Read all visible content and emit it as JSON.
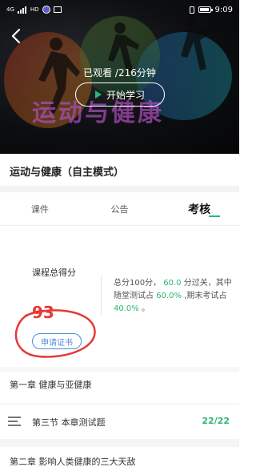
{
  "status_bar": {
    "time": "9:09",
    "network_tag_1": "4G",
    "network_tag_2": "HD"
  },
  "hero": {
    "watched_text": "已观看    /216分钟",
    "start_button": "开始学习",
    "banner_text": "运动与健康"
  },
  "course": {
    "title": "运动与健康（自主模式）"
  },
  "tabs": [
    {
      "label": "课件",
      "active": false
    },
    {
      "label": "公告",
      "active": false
    },
    {
      "label": "考核",
      "active": true
    }
  ],
  "score": {
    "label": "课程总得分",
    "value": "93",
    "apply_button": "申请证书"
  },
  "description": {
    "part1": "总分100分，",
    "pass_score": "60.0",
    "part2": " 分过关，其中随堂测试占 ",
    "quiz_pct": "60.0%",
    "part3": ",期末考试占 ",
    "final_pct": "40.0%",
    "part4": "。"
  },
  "chapters": {
    "chapter1": "第一章  健康与亚健康",
    "section_title": "第三节  本章测试题",
    "section_count": "22/22",
    "chapter2": "第二章  影响人类健康的三大天敌"
  },
  "colors": {
    "accent_green": "#2bb673",
    "score_red": "#e53935",
    "link_blue": "#4a90d9"
  }
}
